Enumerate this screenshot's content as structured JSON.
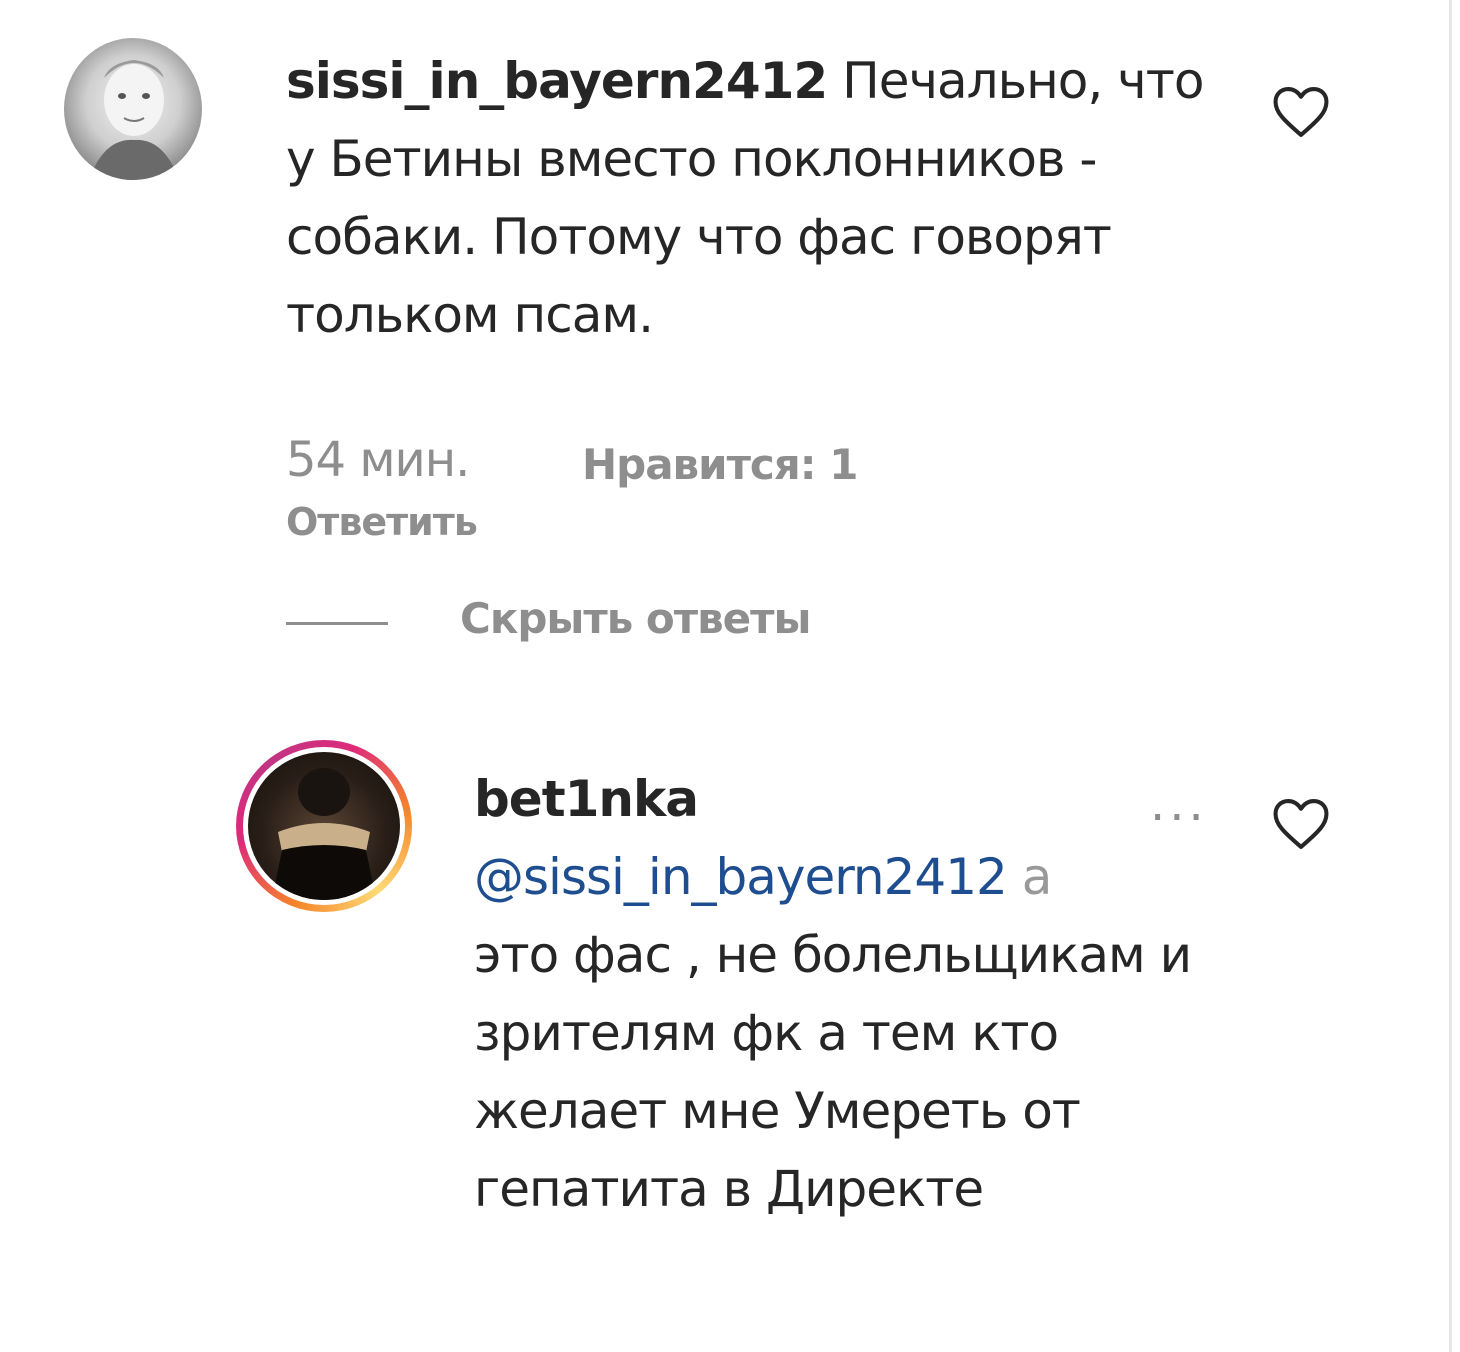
{
  "comment": {
    "username": "sissi_in_bayern2412",
    "text": "Печально, что у Бетины вместо поклонников - собаки. Потому что фас говорят тольком псам.",
    "time": "54 мин.",
    "likes": "Нравится: 1",
    "reply_label": "Ответить",
    "hide_replies_label": "Скрыть ответы"
  },
  "reply": {
    "username": "bet1nka",
    "mention": "@sissi_in_bayern2412",
    "cut_char": "а",
    "text": "это фас , не болельщикам и зрителям фк а тем кто желает мне Умереть от гепатита в Директе",
    "more": "···"
  },
  "icons": {
    "like": "heart-outline-icon",
    "more": "more-options-icon"
  },
  "colors": {
    "text": "#262626",
    "muted": "#8e8e8e",
    "mention": "#1e4e8f",
    "story_ring_start": "#f58529",
    "story_ring_end": "#dd2a7b"
  }
}
